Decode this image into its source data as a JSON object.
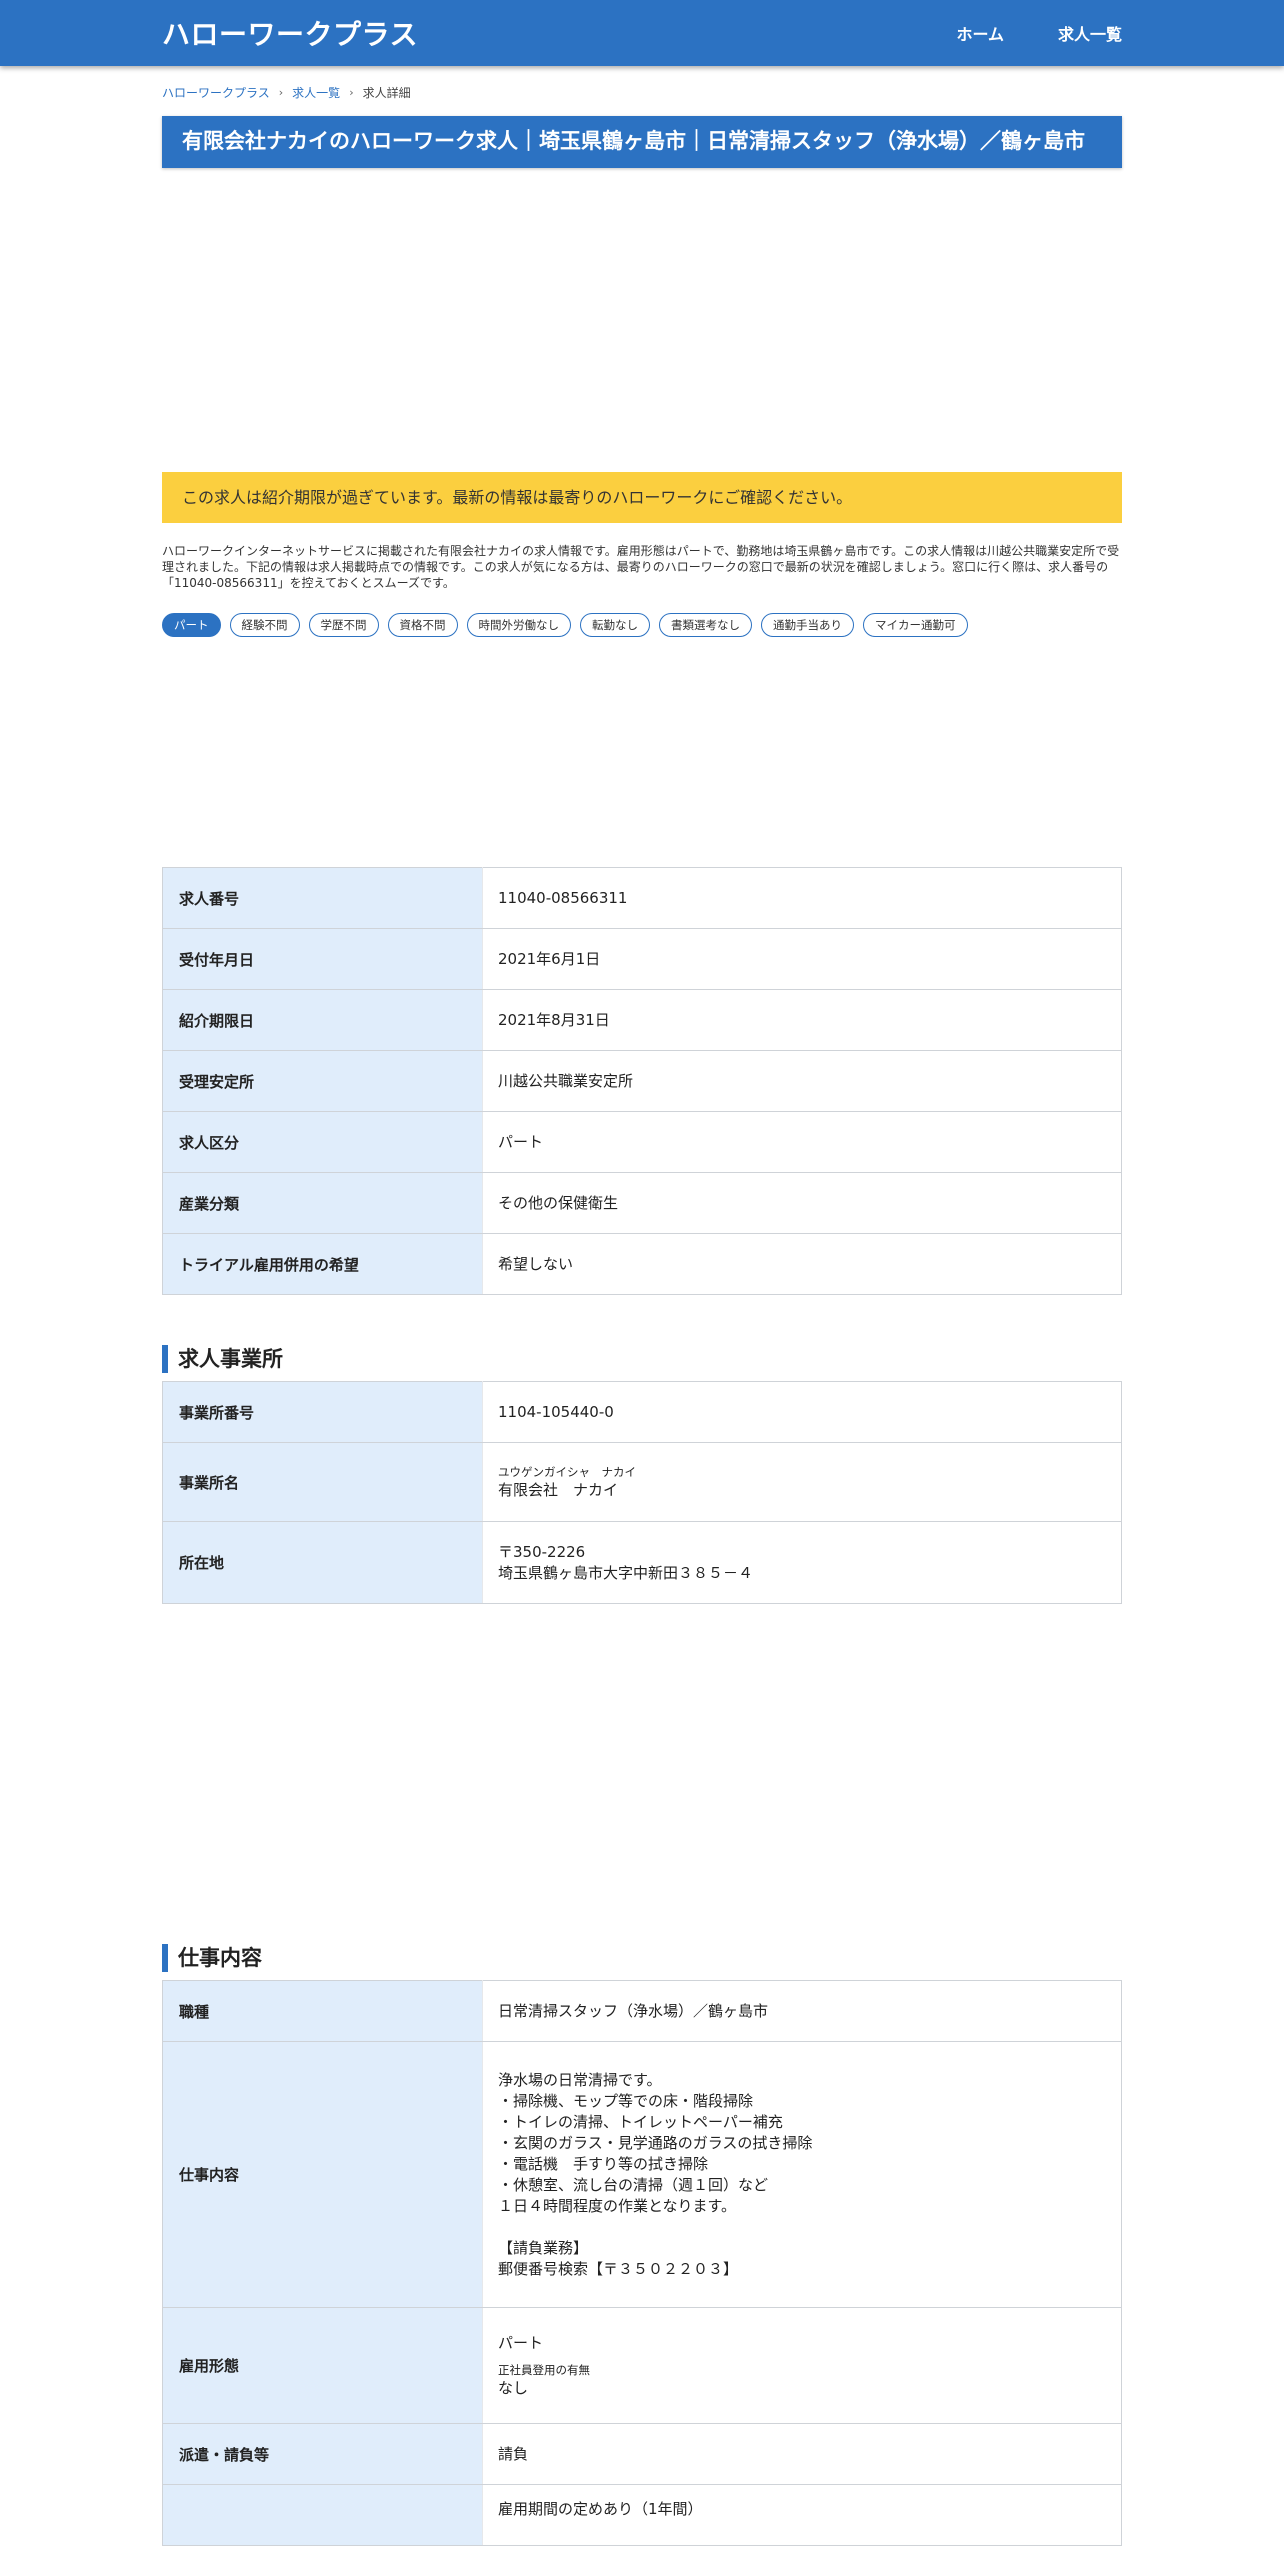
{
  "header": {
    "logo": "ハローワークプラス",
    "nav": [
      "ホーム",
      "求人一覧"
    ]
  },
  "breadcrumb": [
    "ハローワークプラス",
    "求人一覧",
    "求人詳細"
  ],
  "page_title": "有限会社ナカイのハローワーク求人｜埼玉県鶴ヶ島市｜日常清掃スタッフ（浄水場）／鶴ヶ島市",
  "notice": "この求人は紹介期限が過ぎています。最新の情報は最寄りのハローワークにご確認ください。",
  "description": "ハローワークインターネットサービスに掲載された有限会社ナカイの求人情報です。雇用形態はパートで、勤務地は埼玉県鶴ヶ島市です。この求人情報は川越公共職業安定所で受理されました。下記の情報は求人掲載時点での情報です。この求人が気になる方は、最寄りのハローワークの窓口で最新の状況を確認しましょう。窓口に行く際は、求人番号の「11040-08566311」を控えておくとスムーズです。",
  "tags": [
    "パート",
    "経験不問",
    "学歴不問",
    "資格不問",
    "時間外労働なし",
    "転勤なし",
    "書類選考なし",
    "通勤手当あり",
    "マイカー通勤可"
  ],
  "basic_info": [
    {
      "label": "求人番号",
      "value": "11040-08566311"
    },
    {
      "label": "受付年月日",
      "value": "2021年6月1日"
    },
    {
      "label": "紹介期限日",
      "value": "2021年8月31日"
    },
    {
      "label": "受理安定所",
      "value": "川越公共職業安定所"
    },
    {
      "label": "求人区分",
      "value": "パート"
    },
    {
      "label": "産業分類",
      "value": "その他の保健衛生"
    },
    {
      "label": "トライアル雇用併用の希望",
      "value": "希望しない"
    }
  ],
  "office_section": {
    "title": "求人事業所",
    "office_number_label": "事業所番号",
    "office_number": "1104-105440-0",
    "office_name_label": "事業所名",
    "office_name_kana": "ユウゲンガイシャ　ナカイ",
    "office_name": "有限会社　ナカイ",
    "address_label": "所在地",
    "postal_code": "〒350-2226",
    "address": "埼玉県鶴ヶ島市大字中新田３８５－４"
  },
  "job_section": {
    "title": "仕事内容",
    "occupation_label": "職種",
    "occupation": "日常清掃スタッフ（浄水場）／鶴ヶ島市",
    "content_label": "仕事内容",
    "content": "浄水場の日常清掃です。\n・掃除機、モップ等での床・階段掃除\n・トイレの清掃、トイレットペーパー補充\n・玄関のガラス・見学通路のガラスの拭き掃除\n・電話機　手すり等の拭き掃除\n・休憩室、流し台の清掃（週１回）など\n１日４時間程度の作業となります。",
    "content_extra": "【請負業務】\n郵便番号検索【〒３５０２２０３】",
    "employment_label": "雇用形態",
    "employment": "パート",
    "regular_label": "正社員登用の有無",
    "regular": "なし",
    "dispatch_label": "派遣・請負等",
    "dispatch": "請負",
    "next_value": "雇用期間の定めあり（1年間）"
  }
}
